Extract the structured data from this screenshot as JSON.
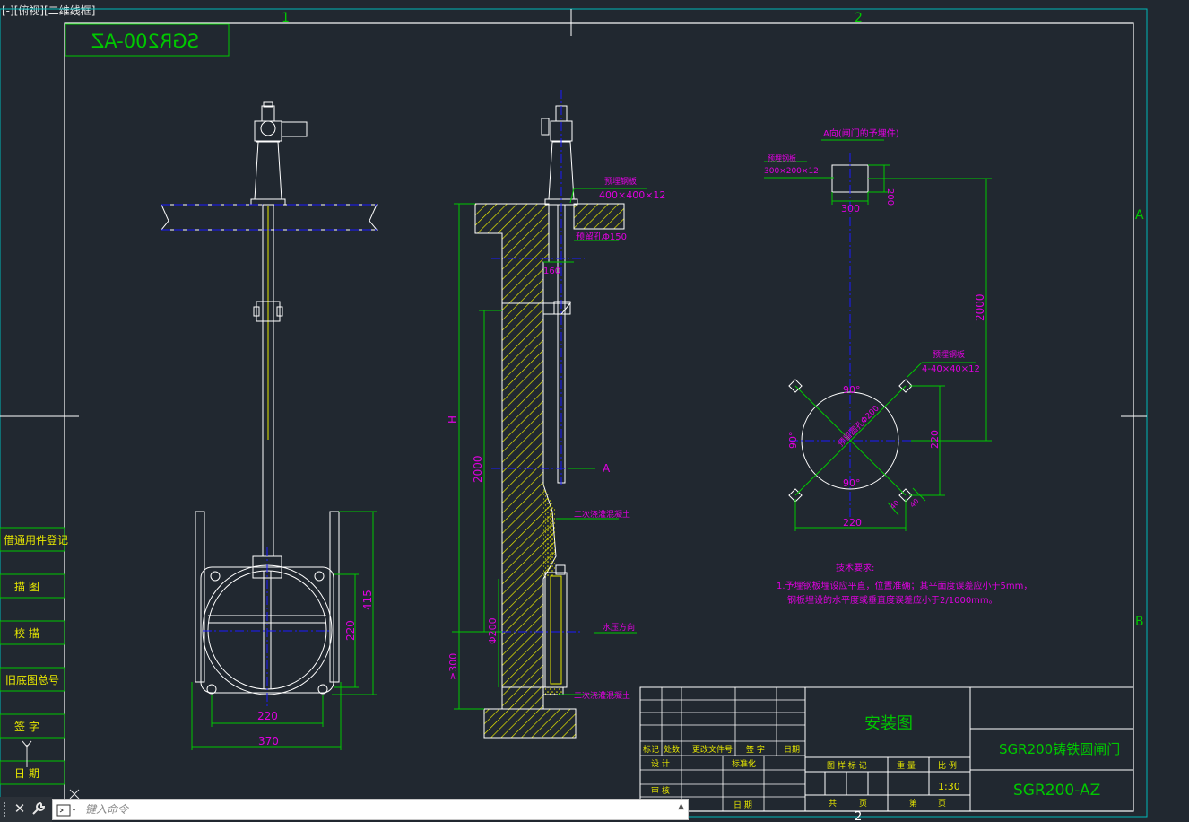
{
  "viewport_label": "[-][俯视][二维线框]",
  "grid": {
    "col1": "1",
    "col2": "2",
    "row_a": "A",
    "row_b": "B",
    "col2_bottom": "2"
  },
  "mirrored_title": "SGR200-AZ",
  "side_labels": [
    "借通用件登记",
    "描 图",
    "校 描",
    "旧底图总号",
    "签 字",
    "日 期"
  ],
  "front_view": {
    "width_inner": "220",
    "width_outer": "370",
    "height_415": "415",
    "height_220": "220"
  },
  "section_view": {
    "plate_label": "预埋钢板",
    "plate_size": "400×400×12",
    "hole_label": "预留孔Φ150",
    "dim_160": "160",
    "dim_H": "H",
    "dim_2000": "2000",
    "arrow_a": "A",
    "concrete_top": "二次浇灌混凝土",
    "water_dir": "水压方向",
    "dim_phi200": "Φ200",
    "dim_ge300": "≥300",
    "concrete_bottom": "二次浇灌混凝土"
  },
  "view_a": {
    "title": "A向(闸门的予埋件)",
    "plate_label": "预埋钢板",
    "plate_size": "300×200×12",
    "dim_300": "300",
    "dim_200": "200",
    "dim_2000": "2000",
    "corner_label": "预埋钢板",
    "corner_size": "4-40×40×12",
    "angle_top": "90°",
    "angle_left": "90°",
    "angle_bottom": "90°",
    "center_label": "预留圆孔Φ200",
    "dim_220v": "220",
    "dim_220h": "220",
    "dim_40a": "40",
    "dim_40b": "40"
  },
  "tech_req": {
    "title": "技术要求:",
    "line1": "1.予埋钢板埋设应平直，位置准确；其平面度误差应小于5mm，",
    "line2": "钢板埋设的水平度或垂直度误差应小于2/1000mm。"
  },
  "title_block": {
    "drawing_name": "安装图",
    "product_name": "SGR200铸铁圆闸门",
    "code": "SGR200-AZ",
    "scale": "1:30",
    "labels": {
      "biaoji": "标记",
      "chushu": "处数",
      "genggai": "更改文件号",
      "qianzi": "签 字",
      "riqi": "日期",
      "sheji": "设 计",
      "biaozhunhua": "标准化",
      "shenhe": "审 核",
      "riqi2": "日 期",
      "tuyang": "图 样 标 记",
      "zhongliang": "重 量",
      "bili": "比 例",
      "gong": "共",
      "zhang1": "页",
      "di": "第",
      "zhang2": "页"
    }
  },
  "command_line": {
    "placeholder": "键入命令"
  },
  "colors": {
    "bg": "#212830",
    "frame": "#ffffff",
    "grid": "#00b8b8",
    "green": "#00c800",
    "magenta": "#e000e0",
    "yellow": "#e8e800",
    "blue": "#1a1aff"
  }
}
